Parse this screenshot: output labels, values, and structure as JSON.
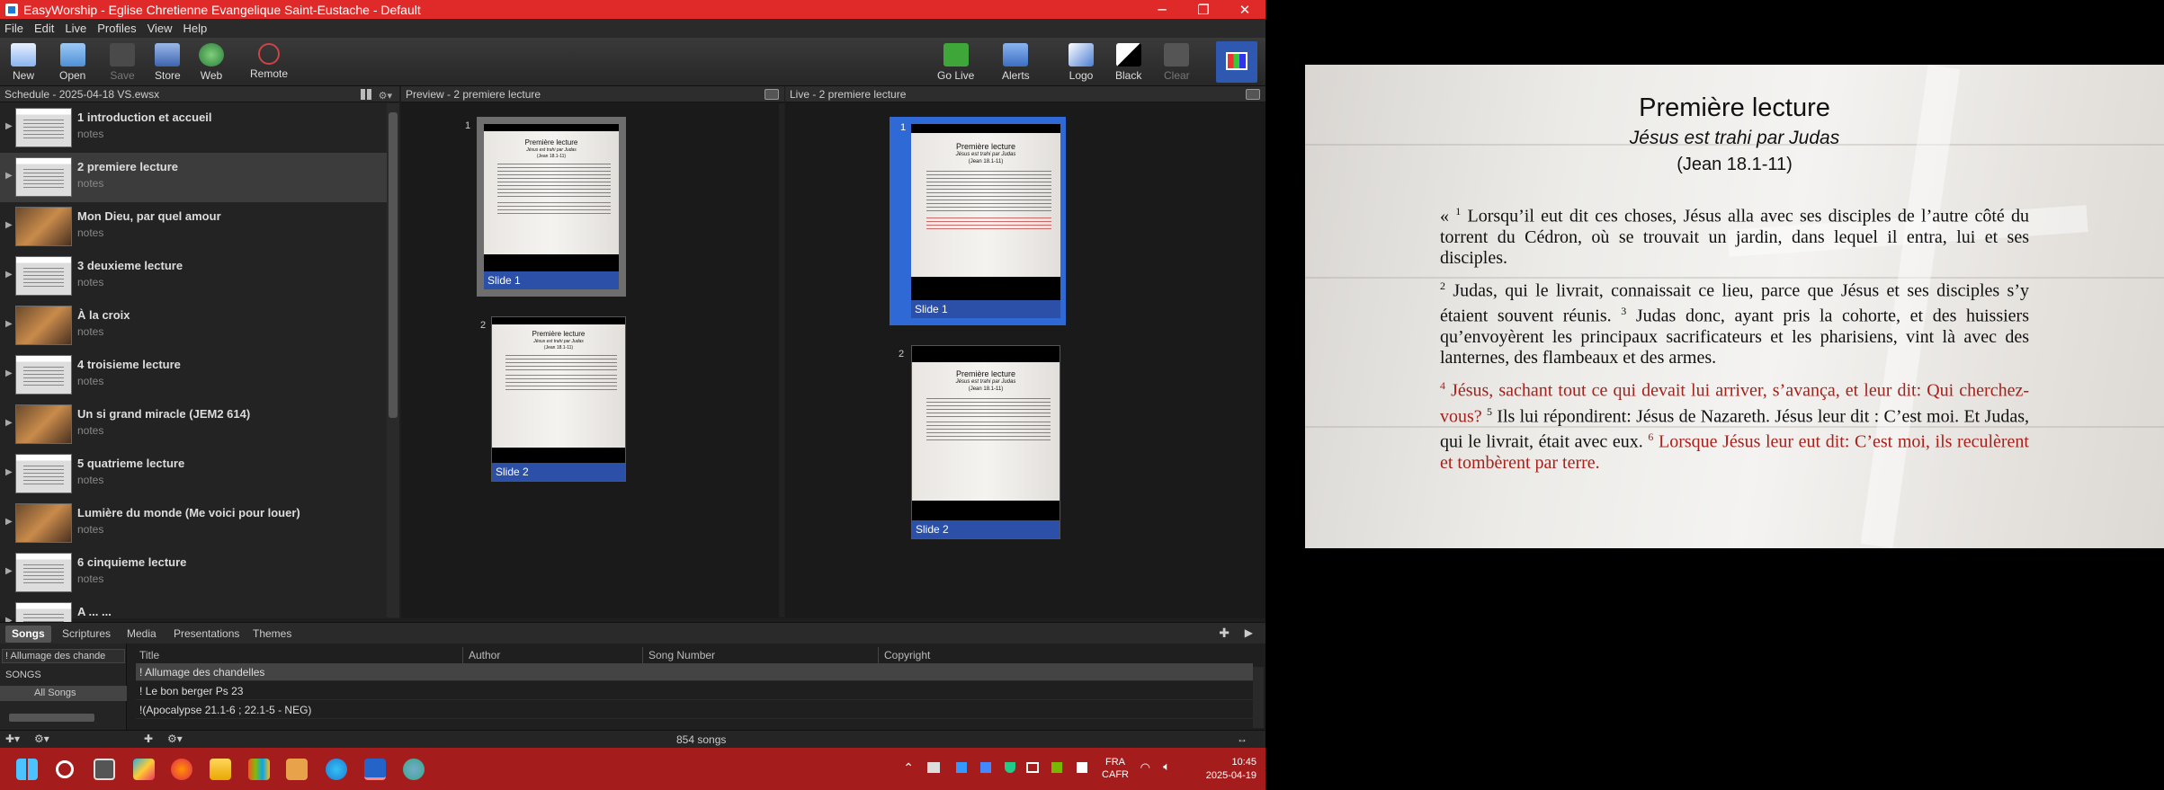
{
  "window": {
    "title": "EasyWorship - Eglise Chretienne Evangelique Saint-Eustache - Default"
  },
  "menu": [
    "File",
    "Edit",
    "Live",
    "Profiles",
    "View",
    "Help"
  ],
  "toolbar": {
    "new": "New",
    "open": "Open",
    "save": "Save",
    "store": "Store",
    "web": "Web",
    "remote": "Remote",
    "golive": "Go Live",
    "alerts": "Alerts",
    "logo": "Logo",
    "black": "Black",
    "clear": "Clear"
  },
  "schedule": {
    "header": "Schedule - 2025-04-18 VS.ewsx",
    "items": [
      {
        "name": "1 introduction et accueil",
        "notes": "notes"
      },
      {
        "name": "2 premiere lecture",
        "notes": "notes"
      },
      {
        "name": "Mon Dieu, par quel amour",
        "notes": "notes"
      },
      {
        "name": "3 deuxieme lecture",
        "notes": "notes"
      },
      {
        "name": "À la croix",
        "notes": "notes"
      },
      {
        "name": "4 troisieme lecture",
        "notes": "notes"
      },
      {
        "name": "Un si grand miracle (JEM2 614)",
        "notes": "notes"
      },
      {
        "name": "5 quatrieme lecture",
        "notes": "notes"
      },
      {
        "name": "Lumière du monde (Me voici pour louer)",
        "notes": "notes"
      },
      {
        "name": "6 cinquieme lecture",
        "notes": "notes"
      },
      {
        "name": "A ... ...",
        "notes": ""
      }
    ]
  },
  "preview": {
    "header": "Preview - 2 premiere lecture",
    "slides": [
      {
        "num": "1",
        "label": "Slide 1"
      },
      {
        "num": "2",
        "label": "Slide 2"
      }
    ]
  },
  "live": {
    "header": "Live - 2 premiere lecture",
    "slides": [
      {
        "num": "1",
        "label": "Slide 1"
      },
      {
        "num": "2",
        "label": "Slide 2"
      }
    ]
  },
  "slide_text": {
    "title": "Première lecture",
    "subtitle": "Jésus est trahi par Judas",
    "ref": "(Jean 18.1-11)"
  },
  "library": {
    "tabs": [
      "Songs",
      "Scriptures",
      "Media",
      "Presentations",
      "Themes"
    ],
    "filter_value": "! Allumage des chande",
    "tree_header": "SONGS",
    "tree_item": "All Songs",
    "columns": [
      "Title",
      "Author",
      "Song Number",
      "Copyright"
    ],
    "rows": [
      "! Allumage des chandelles",
      "! Le bon berger Ps 23",
      "!(Apocalypse 21.1-6 ; 22.1-5 - NEG)"
    ],
    "count": "854 songs"
  },
  "taskbar": {
    "lang1": "FRA",
    "lang2": "CAFR",
    "time": "10:45",
    "date": "2025-04-19"
  },
  "live_output": {
    "title": "Première lecture",
    "subtitle": "Jésus est trahi par Judas",
    "ref": "(Jean 18.1-11)",
    "p1_open": "« ",
    "v1": "1",
    "p1": " Lorsqu’il eut dit ces choses, Jésus alla avec ses disciples de l’autre côté du torrent du Cédron, où se trouvait un jardin, dans lequel il entra, lui et ses disciples.",
    "v2": "2",
    "p2a": " Judas, qui le livrait, connaissait ce lieu, parce que Jésus et ses disciples s’y étaient souvent réunis. ",
    "v3": "3",
    "p2b": " Judas donc, ayant pris la cohorte, et des huissiers qu’envoyèrent les principaux sacrificateurs et les pharisiens, vint là avec des lanternes, des flambeaux et des armes.",
    "v4": "4",
    "p3a": " Jésus, sachant tout ce qui devait lui arriver, s’avança, et leur dit: Qui cherchez-vous?",
    "v5": "5",
    "p3b": " Ils lui répondirent: Jésus de Nazareth. Jésus leur dit : C’est moi. Et Judas, qui le livrait, était avec eux. ",
    "v6": "6",
    "p3c": " Lorsque Jésus leur eut dit: C’est moi, ils reculèrent et tombèrent par terre.",
    "red_color": "#a8201a"
  }
}
